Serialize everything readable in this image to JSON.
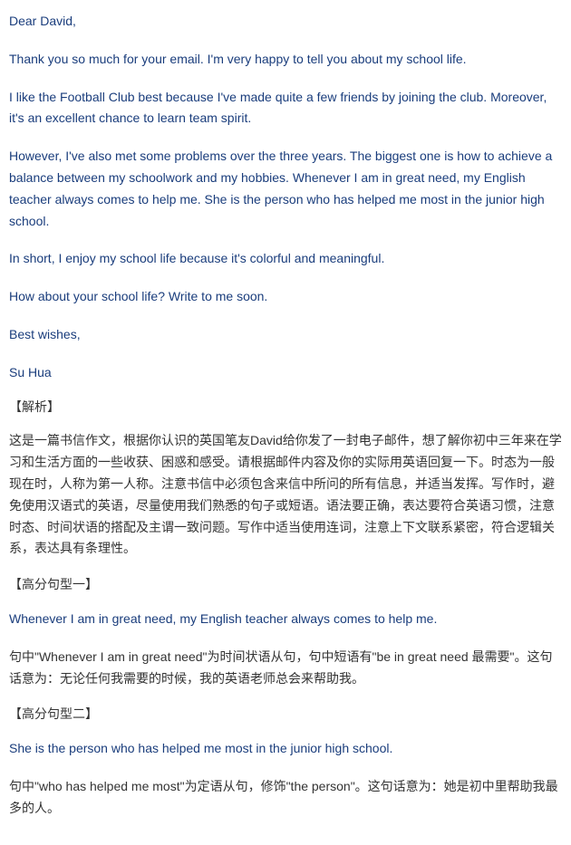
{
  "letter": {
    "greeting": "Dear David,",
    "p1": "Thank you so much for your email. I'm very happy to tell you about my school life.",
    "p2": "I like the Football Club best because I've made quite a few friends by joining the club. Moreover, it's an excellent chance to learn team spirit.",
    "p3": "However, I've also met some problems over the three years. The biggest one is how to achieve a balance between my schoolwork and my hobbies. Whenever I am in great need, my English teacher always comes to help me. She is the person who has helped me most in the junior high school.",
    "p4": "In short, I enjoy my school life because it's colorful and meaningful.",
    "p5": "How about your school life? Write to me soon.",
    "closing": "Best wishes,",
    "signature": "Su Hua"
  },
  "analysis": {
    "header": "【解析】",
    "body": "这是一篇书信作文，根据你认识的英国笔友David给你发了一封电子邮件，想了解你初中三年来在学习和生活方面的一些收获、困惑和感受。请根据邮件内容及你的实际用英语回复一下。时态为一般现在时，人称为第一人称。注意书信中必须包含来信中所问的所有信息，并适当发挥。写作时，避免使用汉语式的英语，尽量使用我们熟悉的句子或短语。语法要正确，表达要符合英语习惯，注意时态、时间状语的搭配及主谓一致问题。写作中适当使用连词，注意上下文联系紧密，符合逻辑关系，表达具有条理性。"
  },
  "sentence1": {
    "header": "【高分句型一】",
    "english": "Whenever I am in great need, my English teacher always comes to help me.",
    "explanation": "句中\"Whenever I am in great need\"为时间状语从句，句中短语有\"be in great need 最需要\"。这句话意为：无论任何我需要的时候，我的英语老师总会来帮助我。"
  },
  "sentence2": {
    "header": "【高分句型二】",
    "english": "She is the person who has helped me most in the junior high school.",
    "explanation": "句中\"who has helped me most\"为定语从句，修饰\"the person\"。这句话意为：她是初中里帮助我最多的人。"
  }
}
